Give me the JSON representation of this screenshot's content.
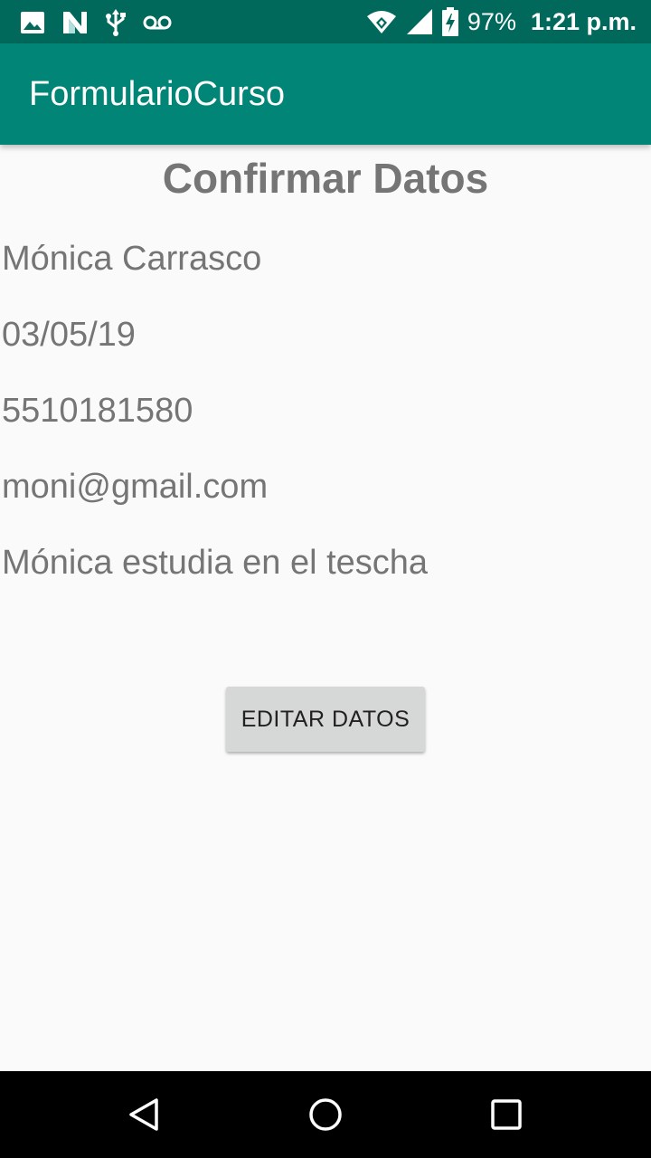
{
  "status_bar": {
    "icons_left": [
      "image-icon",
      "n-logo-icon",
      "usb-icon",
      "voicemail-icon"
    ],
    "icons_right": [
      "wifi-icon",
      "signal-icon",
      "battery-charging-icon"
    ],
    "battery": "97%",
    "time": "1:21 p.m."
  },
  "app_bar": {
    "title": "FormularioCurso",
    "background": "#008577"
  },
  "main": {
    "heading": "Confirmar Datos",
    "fields": [
      "Mónica Carrasco",
      "03/05/19",
      "5510181580",
      "moni@gmail.com",
      "Mónica estudia en el tescha"
    ],
    "edit_button_label": "EDITAR DATOS"
  },
  "nav_bar": {
    "buttons": [
      "back-icon",
      "home-icon",
      "recents-icon"
    ]
  },
  "colors": {
    "status_bar": "#00695c",
    "text": "#757575",
    "button": "#d6d7d7"
  }
}
